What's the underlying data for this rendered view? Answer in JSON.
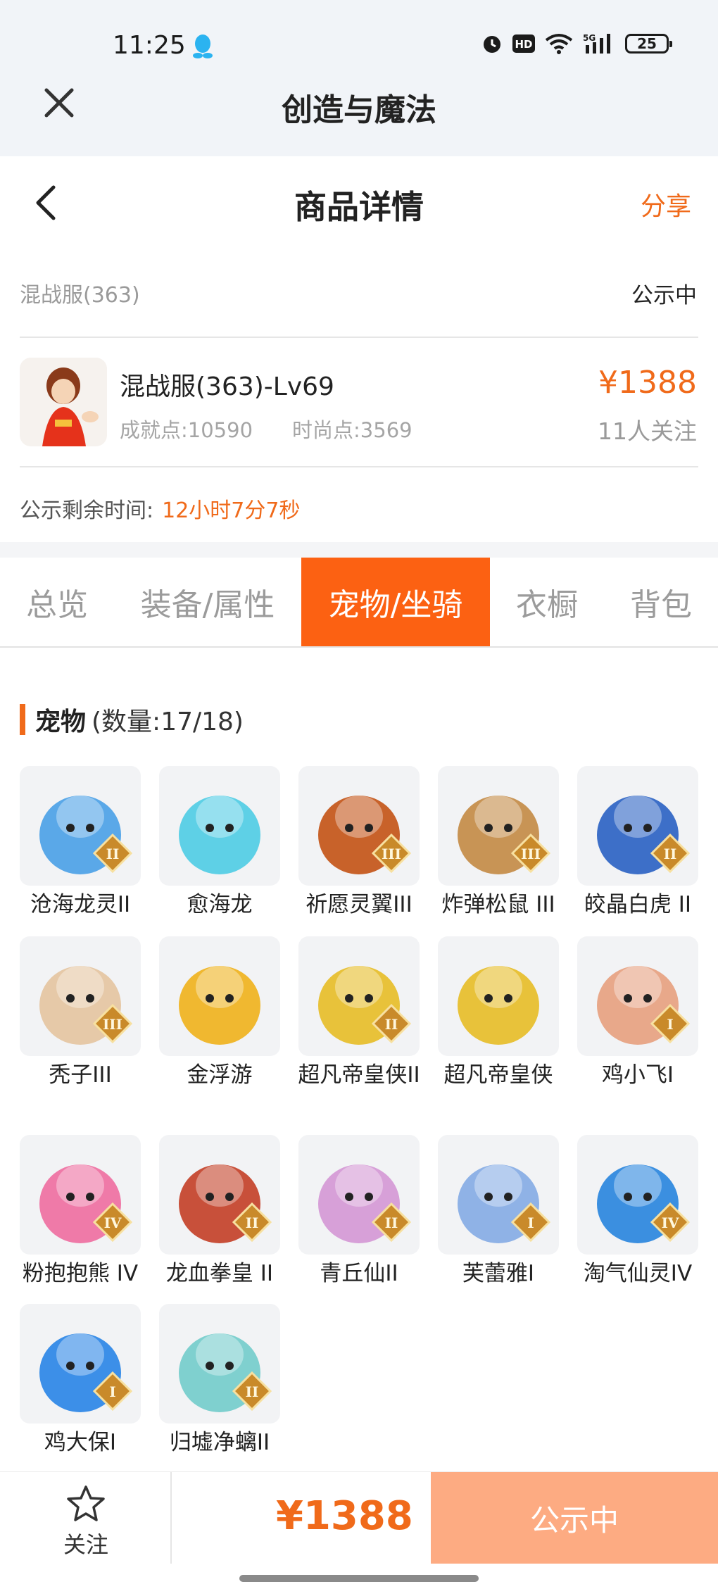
{
  "status_bar": {
    "time": "11:25",
    "battery": "25"
  },
  "app": {
    "title": "创造与魔法",
    "close_icon": "close-icon"
  },
  "header": {
    "title": "商品详情",
    "share": "分享",
    "back_icon": "chevron-left-icon"
  },
  "listing": {
    "server": "混战服(363)",
    "status": "公示中",
    "character_name": "混战服(363)-Lv69",
    "achievement": "成就点:10590",
    "fashion": "时尚点:3569",
    "price": "¥1388",
    "followers": "11人关注",
    "time_label": "公示剩余时间:",
    "time_value": "12小时7分7秒"
  },
  "tabs": [
    "总览",
    "装备/属性",
    "宠物/坐骑",
    "衣橱",
    "背包"
  ],
  "active_tab": 2,
  "pets_section": {
    "title": "宠物",
    "count": "(数量:17/18)"
  },
  "pets": [
    {
      "name": "沧海龙灵II",
      "tier": "II",
      "color": "#5aa8e8"
    },
    {
      "name": "愈海龙",
      "tier": "",
      "color": "#5ed0e6"
    },
    {
      "name": "祈愿灵翼III",
      "tier": "III",
      "color": "#c8622a"
    },
    {
      "name": "炸弹松鼠 III",
      "tier": "III",
      "color": "#c89455"
    },
    {
      "name": "皎晶白虎 II",
      "tier": "II",
      "color": "#3d6fc8"
    },
    {
      "name": "秃子III",
      "tier": "III",
      "color": "#e6c9a8"
    },
    {
      "name": "金浮游",
      "tier": "",
      "color": "#f0b830"
    },
    {
      "name": "超凡帝皇侠II",
      "tier": "II",
      "color": "#e8c23a"
    },
    {
      "name": "超凡帝皇侠",
      "tier": "",
      "color": "#e8c23a"
    },
    {
      "name": "鸡小飞I",
      "tier": "I",
      "color": "#e8a88a"
    },
    {
      "name": "粉抱抱熊 IV",
      "tier": "IV",
      "color": "#ef7aa8"
    },
    {
      "name": "龙血拳皇 II",
      "tier": "II",
      "color": "#c8503a"
    },
    {
      "name": "青丘仙II",
      "tier": "II",
      "color": "#d7a0d8"
    },
    {
      "name": "芙蕾雅I",
      "tier": "I",
      "color": "#8fb2e6"
    },
    {
      "name": "淘气仙灵IV",
      "tier": "IV",
      "color": "#3b8fe0"
    },
    {
      "name": "鸡大保I",
      "tier": "I",
      "color": "#3c8fe8"
    },
    {
      "name": "归墟净螭II",
      "tier": "II",
      "color": "#7fd0cf"
    }
  ],
  "bottom_bar": {
    "favorite": "关注",
    "price": "¥1388",
    "action": "公示中"
  },
  "colors": {
    "accent": "#f06a1a",
    "tab_active": "#fc6112",
    "cta": "#fdab82"
  }
}
